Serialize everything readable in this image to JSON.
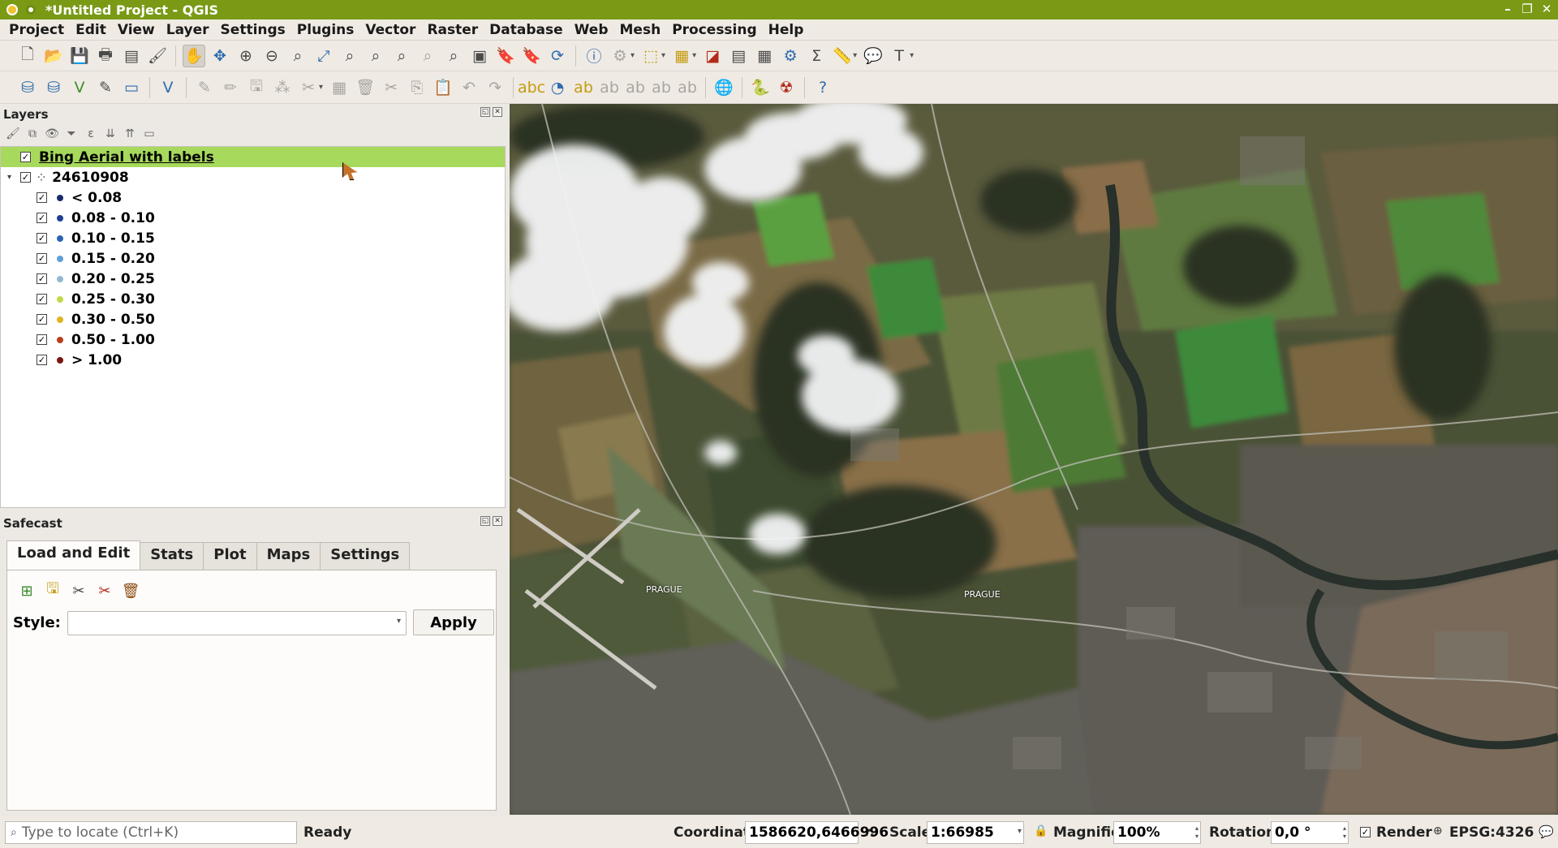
{
  "window": {
    "title": "*Untitled Project - QGIS",
    "controls": [
      "–",
      "❐",
      "✕"
    ]
  },
  "menu": [
    "Project",
    "Edit",
    "View",
    "Layer",
    "Settings",
    "Plugins",
    "Vector",
    "Raster",
    "Database",
    "Web",
    "Mesh",
    "Processing",
    "Help"
  ],
  "layers_panel": {
    "title": "Layers",
    "layers": [
      {
        "label": "Bing Aerial with labels",
        "checked": true,
        "selected": true
      },
      {
        "label": "24610908",
        "checked": true,
        "expanded": true
      }
    ],
    "classes": [
      {
        "label": "< 0.08",
        "color": "#1a2a6c"
      },
      {
        "label": "0.08 - 0.10",
        "color": "#1e3f94"
      },
      {
        "label": "0.10 - 0.15",
        "color": "#2a65b3"
      },
      {
        "label": "0.15 - 0.20",
        "color": "#5ea0d8"
      },
      {
        "label": "0.20 - 0.25",
        "color": "#93b9cf"
      },
      {
        "label": "0.25 - 0.30",
        "color": "#c3d94a"
      },
      {
        "label": "0.30 - 0.50",
        "color": "#e0b320"
      },
      {
        "label": "0.50 - 1.00",
        "color": "#b8401b"
      },
      {
        "label": "> 1.00",
        "color": "#7a1710"
      }
    ]
  },
  "safecast_panel": {
    "title": "Safecast",
    "tabs": [
      "Load and Edit",
      "Stats",
      "Plot",
      "Maps",
      "Settings"
    ],
    "active_tab": "Load and Edit",
    "style_label": "Style:",
    "style_value": "",
    "apply_label": "Apply"
  },
  "map": {
    "labels": [
      "PRAGUE",
      "PRAGUE"
    ]
  },
  "statusbar": {
    "locator_placeholder": "Type to locate (Ctrl+K)",
    "status": "Ready",
    "coordinate_label": "Coordinate",
    "coordinate_value": "1586620,6466996",
    "scale_label": "Scale",
    "scale_value": "1:66985",
    "magnifier_label": "Magnifier",
    "magnifier_value": "100%",
    "rotation_label": "Rotation",
    "rotation_value": "0,0 °",
    "render_label": "Render",
    "crs": "EPSG:4326"
  }
}
